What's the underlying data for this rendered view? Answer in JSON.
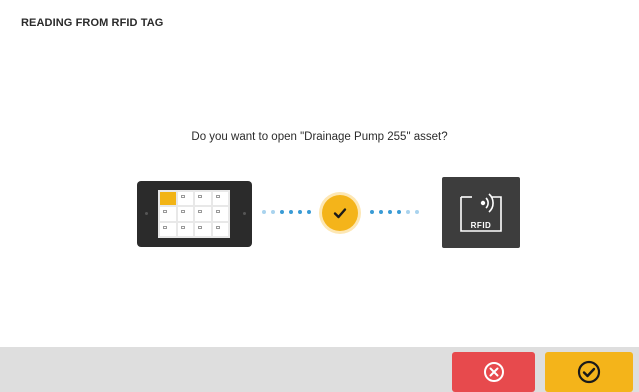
{
  "header": {
    "title": "READING FROM RFID TAG"
  },
  "dialog": {
    "prompt": "Do you want to open \"Drainage Pump 255\" asset?"
  },
  "rfid": {
    "label": "RFID"
  },
  "colors": {
    "accent": "#f4b41a",
    "cancel": "#e74a4d",
    "connector": "#3a9bd5",
    "device": "#2b2b2b"
  },
  "icons": {
    "cancel": "close-circle-icon",
    "confirm": "check-circle-icon",
    "status": "check-icon"
  }
}
